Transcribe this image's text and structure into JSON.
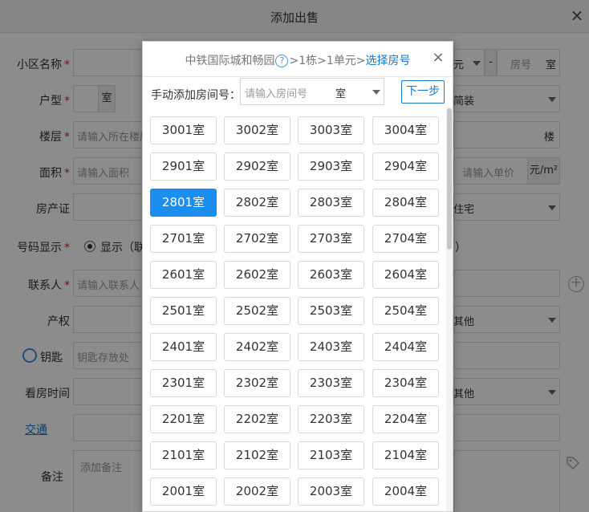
{
  "dialog": {
    "title": "添加出售",
    "close_glyph": "×"
  },
  "form": {
    "community": {
      "label": "小区名称",
      "required_mark": "*",
      "room_no_placeholder": "房号",
      "room_unit": "室",
      "dash": "-",
      "partial_tail": "元"
    },
    "layout": {
      "label": "户型",
      "required_mark": "*",
      "unit": "室",
      "decor_partial": "简装"
    },
    "floor": {
      "label": "楼层",
      "required_mark": "*",
      "placeholder": "请输入所在楼层",
      "unit": "楼"
    },
    "area": {
      "label": "面积",
      "required_mark": "*",
      "placeholder": "请输入面积",
      "price_placeholder": "请输入单价",
      "price_unit": "元/m²"
    },
    "deed": {
      "label": "房产证",
      "type_partial": "住宅"
    },
    "number_display": {
      "label": "号码显示",
      "required_mark": "*",
      "option_visible": "显示（联",
      "tail": "）"
    },
    "contact": {
      "label": "联系人",
      "required_mark": "*",
      "placeholder": "请输入联系人"
    },
    "ownership": {
      "label": "产权",
      "value_partial": "其他"
    },
    "key": {
      "label": "钥匙",
      "placeholder": "钥匙存放处"
    },
    "viewing": {
      "label": "看房时间",
      "value_partial": "其他"
    },
    "traffic": {
      "label": "交通"
    },
    "remark": {
      "label": "备注",
      "placeholder": "添加备注"
    }
  },
  "popup": {
    "breadcrumb": {
      "community": "中铁国际城和畅园",
      "building": "1栋",
      "unit": "1单元",
      "current": "选择房号",
      "separator": ">"
    },
    "help_glyph": "?",
    "close_glyph": "×",
    "manual_label": "手动添加房间号：",
    "manual_placeholder": "请输入房间号",
    "manual_unit": "室",
    "next_label": "下一步",
    "selected_room": "2801室",
    "rooms": [
      [
        "3001室",
        "3002室",
        "3003室",
        "3004室"
      ],
      [
        "2901室",
        "2902室",
        "2903室",
        "2904室"
      ],
      [
        "2801室",
        "2802室",
        "2803室",
        "2804室"
      ],
      [
        "2701室",
        "2702室",
        "2703室",
        "2704室"
      ],
      [
        "2601室",
        "2602室",
        "2603室",
        "2604室"
      ],
      [
        "2501室",
        "2502室",
        "2503室",
        "2504室"
      ],
      [
        "2401室",
        "2402室",
        "2403室",
        "2404室"
      ],
      [
        "2301室",
        "2302室",
        "2303室",
        "2304室"
      ],
      [
        "2201室",
        "2202室",
        "2203室",
        "2204室"
      ],
      [
        "2101室",
        "2102室",
        "2103室",
        "2104室"
      ],
      [
        "2001室",
        "2002室",
        "2003室",
        "2004室"
      ]
    ]
  },
  "colors": {
    "accent": "#1a78c8",
    "selected": "#1b8ef0",
    "required": "#e02020"
  },
  "icons": [
    "close-icon",
    "help-icon",
    "caret-down-icon",
    "add-circle-icon",
    "tag-icon"
  ]
}
